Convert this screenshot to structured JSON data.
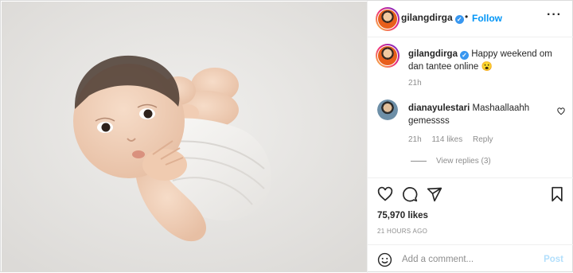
{
  "post": {
    "author": "gilangdirga",
    "follow_label": "Follow",
    "dot": "•",
    "more_label": "···",
    "verified_mark": "✓",
    "photo_icon": "newborn-baby-photo",
    "caption": {
      "username": "gilangdirga",
      "text": "Happy weekend om dan tantee online 😮",
      "time": "21h"
    },
    "comments": [
      {
        "username": "dianayulestari",
        "text": "Mashaallaahh gemessss",
        "time": "21h",
        "likes": "114 likes",
        "reply_label": "Reply",
        "view_replies": "View replies (3)"
      }
    ],
    "actions": {
      "like_icon": "heart-icon",
      "comment_icon": "comment-icon",
      "share_icon": "share-icon",
      "save_icon": "bookmark-icon"
    },
    "likes_count": "75,970 likes",
    "posted_ago": "21 HOURS AGO",
    "add_comment": {
      "placeholder": "Add a comment...",
      "post_label": "Post",
      "emoji_icon": "emoji-icon"
    }
  }
}
